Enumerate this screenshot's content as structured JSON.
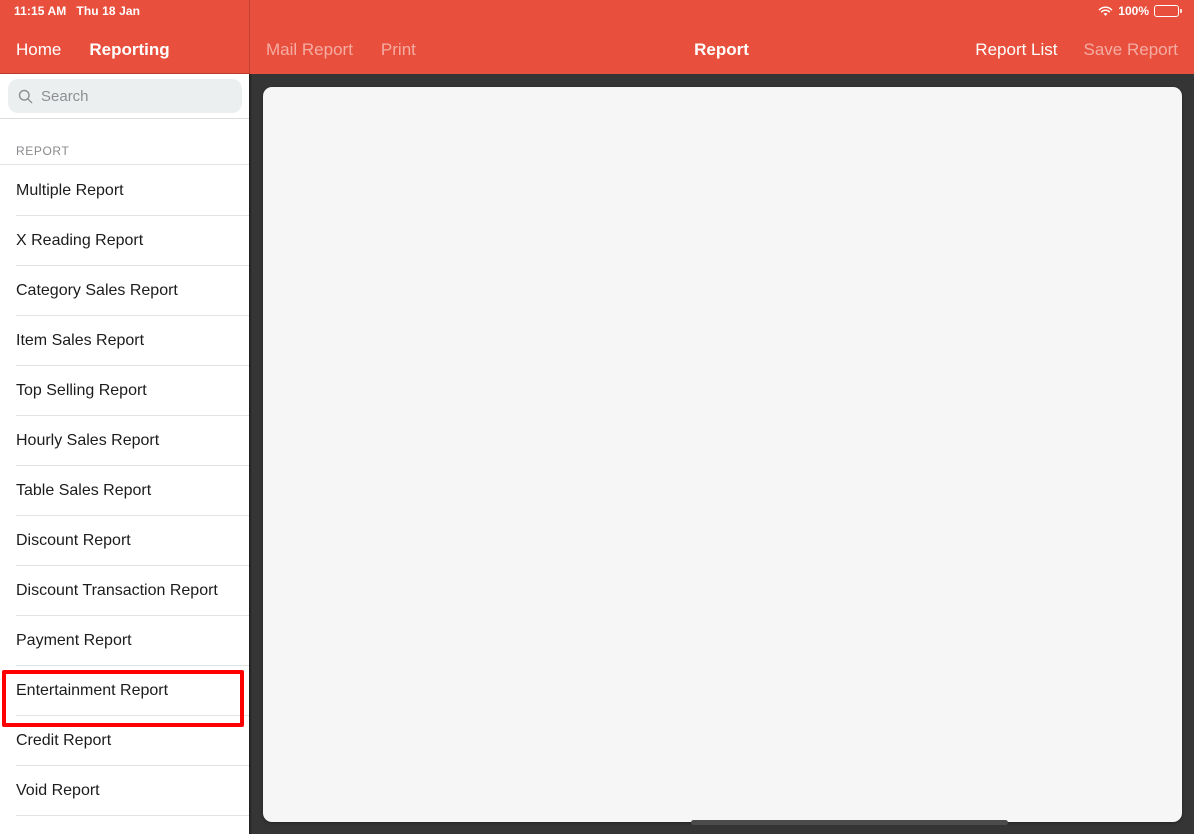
{
  "status_bar": {
    "time": "11:15 AM",
    "date": "Thu 18 Jan",
    "wifi_icon": "wifi-icon",
    "battery_percent": "100%",
    "battery_icon": "battery-full-icon"
  },
  "nav": {
    "home_label": "Home",
    "reporting_label": "Reporting",
    "mail_report_label": "Mail Report",
    "print_label": "Print",
    "title": "Report",
    "report_list_label": "Report List",
    "save_report_label": "Save Report"
  },
  "sidebar": {
    "search": {
      "icon": "search-icon",
      "placeholder": "Search",
      "value": ""
    },
    "section_header": "REPORT",
    "items": [
      {
        "label": "Multiple Report"
      },
      {
        "label": "X Reading Report"
      },
      {
        "label": "Category Sales Report"
      },
      {
        "label": "Item Sales Report"
      },
      {
        "label": "Top Selling Report"
      },
      {
        "label": "Hourly Sales Report"
      },
      {
        "label": "Table Sales Report"
      },
      {
        "label": "Discount Report"
      },
      {
        "label": "Discount Transaction Report"
      },
      {
        "label": "Payment Report"
      },
      {
        "label": "Entertainment Report"
      },
      {
        "label": "Credit Report"
      },
      {
        "label": "Void Report"
      }
    ],
    "highlighted_item": "Entertainment Report"
  },
  "main": {
    "panel_content": ""
  },
  "colors": {
    "accent_red": "#e8503d",
    "highlight_red": "#ff0000",
    "panel_bg": "#f6f6f6",
    "chrome_dark": "#353535"
  }
}
